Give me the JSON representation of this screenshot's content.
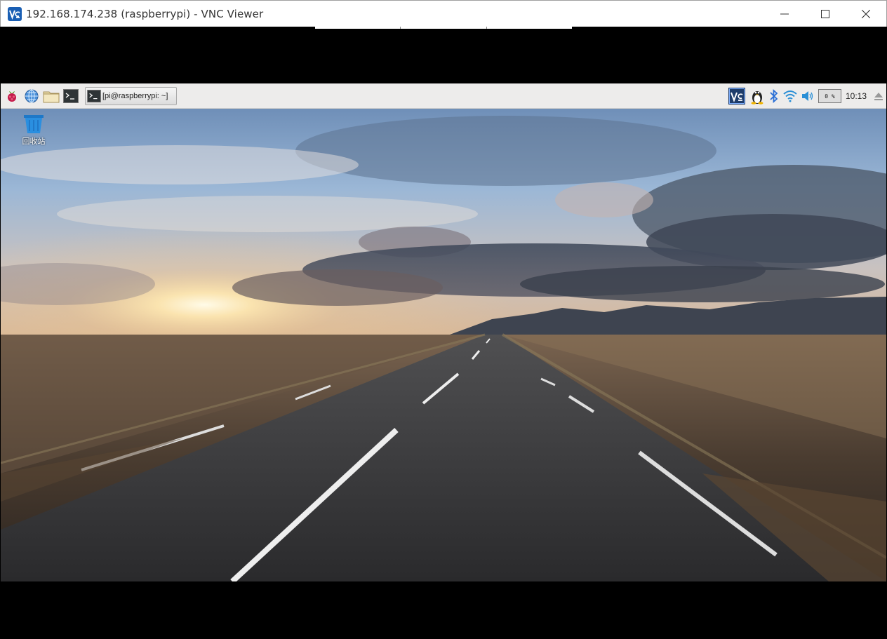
{
  "window": {
    "title": "192.168.174.238 (raspberrypi) - VNC Viewer",
    "app_icon": "vnc-viewer-icon",
    "controls": [
      "minimize-icon",
      "maximize-icon",
      "close-icon"
    ]
  },
  "taskbar": {
    "launchers": [
      "raspberry-menu-icon",
      "web-browser-icon",
      "file-manager-icon",
      "terminal-icon"
    ],
    "task": {
      "label": "[pi@raspberrypi: ~]",
      "icon": "terminal-icon"
    },
    "tray": {
      "icons": [
        "vnc-server-icon",
        "linux-tux-icon",
        "bluetooth-icon",
        "wifi-icon",
        "volume-icon"
      ],
      "cpu_usage": "0 %",
      "clock": "10:13",
      "eject_icon": "eject-icon"
    }
  },
  "desktop": {
    "icons": [
      {
        "label": "回收站",
        "icon": "trash-icon"
      }
    ]
  },
  "colors": {
    "vnc_accent": "#1a5fb4",
    "taskbar_bg": "#edeceb",
    "titlebar_bg": "#ffffff"
  }
}
